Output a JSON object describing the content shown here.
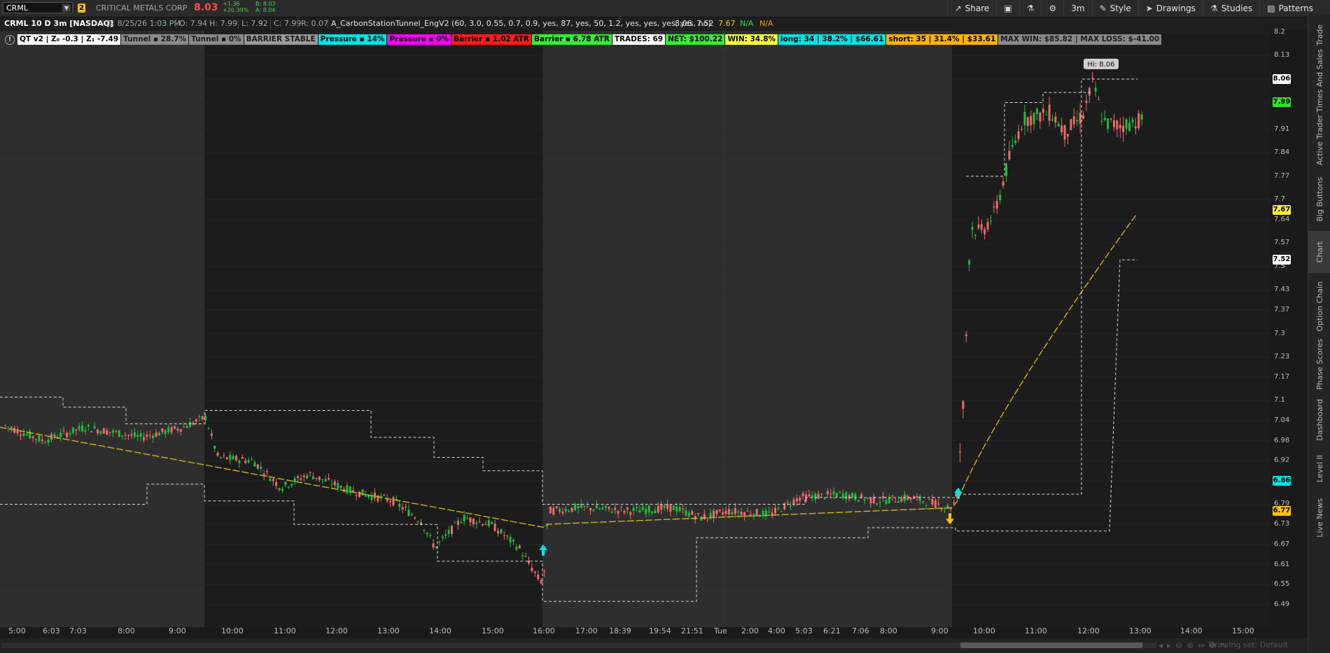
{
  "toolbar": {
    "symbol": "CRML",
    "link_number": "2",
    "company_name": "CRITICAL METALS CORP",
    "last_price": "8.03",
    "change": "+1.36",
    "change_pct": "+20.39%",
    "bid": "B: 8.03",
    "ask": "A: 8.04",
    "share_label": "Share",
    "timeframe_label": "3m",
    "style_label": "Style",
    "drawings_label": "Drawings",
    "studies_label": "Studies",
    "patterns_label": "Patterns"
  },
  "infobar": {
    "title": "CRML 10 D 3m [NASDAQ]",
    "date": "D: 8/25/26 1:03 PM",
    "open": "O: 7.94",
    "high": "H: 7.99",
    "low": "L: 7.92",
    "close": "C: 7.99",
    "range": "R: 0.07",
    "study": "A_CarbonStationTunnel_EngV2 (60, 3.0, 0.55, 0.7, 0.9, yes, 87, yes, 50, 1.2, yes, yes, yes, yes, no)",
    "v1": "8.06",
    "v2": "7.52",
    "v3": "7.67",
    "v4": "N/A",
    "v5": "N/A"
  },
  "stats": [
    {
      "text": "QT v2 | Z₀ -0.3 | Z₁ -7.49",
      "bg": "#ffffff",
      "fg": "#000000"
    },
    {
      "text": "Tunnel ▪ 28.7%",
      "bg": "#8a8a8a",
      "fg": "#1a1a1a"
    },
    {
      "text": "Tunnel ▪ 0%",
      "bg": "#8a8a8a",
      "fg": "#1a1a1a"
    },
    {
      "text": "BARRIER STABLE",
      "bg": "#9a9a9a",
      "fg": "#1a1a1a"
    },
    {
      "text": "Pressure ▪ 14%",
      "bg": "#00e5e5",
      "fg": "#000000"
    },
    {
      "text": "Pressure ▪ 0%",
      "bg": "#ff00ff",
      "fg": "#000000"
    },
    {
      "text": "Barrier ▪ 1.02 ATR",
      "bg": "#ff1a1a",
      "fg": "#000000"
    },
    {
      "text": "Barrier ▪ 6.78 ATR",
      "bg": "#33ee33",
      "fg": "#000000"
    },
    {
      "text": "TRADES: 69",
      "bg": "#ffffff",
      "fg": "#000000"
    },
    {
      "text": "NET: $100.22",
      "bg": "#33ee33",
      "fg": "#000000"
    },
    {
      "text": "WIN: 34.8%",
      "bg": "#ffff33",
      "fg": "#000000"
    },
    {
      "text": "long: 34 | 38.2% | $66.61",
      "bg": "#00e5e5",
      "fg": "#000000"
    },
    {
      "text": "short: 35 | 31.4% | $33.61",
      "bg": "#ffb300",
      "fg": "#000000"
    },
    {
      "text": "MAX WIN: $85.82 | MAX LOSS: $-41.00",
      "bg": "#8a8a8a",
      "fg": "#1a1a1a"
    }
  ],
  "chart": {
    "hi_label": "Hi: 8.06",
    "y_ticks": [
      "8.2",
      "8.13",
      "8.06",
      "7.99",
      "7.91",
      "7.84",
      "7.77",
      "7.7",
      "7.64",
      "7.57",
      "7.5",
      "7.43",
      "7.37",
      "7.3",
      "7.23",
      "7.17",
      "7.1",
      "7.04",
      "6.98",
      "6.92",
      "6.86",
      "6.79",
      "6.73",
      "6.67",
      "6.61",
      "6.55",
      "6.49"
    ],
    "badges": [
      {
        "value": "8.06",
        "bg": "#ffffff",
        "fg": "#000000"
      },
      {
        "value": "7.99",
        "bg": "#33dd33",
        "fg": "#000000"
      },
      {
        "value": "7.67",
        "bg": "#ffee33",
        "fg": "#000000"
      },
      {
        "value": "7.52",
        "bg": "#ffffff",
        "fg": "#000000"
      },
      {
        "value": "6.86",
        "bg": "#00e5e5",
        "fg": "#000000"
      },
      {
        "value": "6.77",
        "bg": "#ffc107",
        "fg": "#000000"
      }
    ],
    "x_ticks": [
      "5:00",
      "6:03",
      "7:03",
      "8:00",
      "9:00",
      "10:00",
      "11:00",
      "12:00",
      "13:00",
      "14:00",
      "15:00",
      "16:00",
      "17:00",
      "18:39",
      "19:54",
      "21:51",
      "Tue",
      "2:00",
      "4:00",
      "5:03",
      "6:21",
      "7:06",
      "8:00",
      "9:00",
      "10:00",
      "11:00",
      "12:00",
      "13:00",
      "14:00",
      "15:00"
    ],
    "colors": {
      "up": "#1fbf3a",
      "down": "#f06a6a",
      "ema": "#c9b51a",
      "band": "#d8d8d8",
      "arrow_up": "#00e5e5",
      "arrow_down": "#ffc107"
    }
  },
  "rail": [
    "Trade",
    "Times And Sales",
    "Active Trader",
    "Big Buttons",
    "Chart",
    "Option Chain",
    "Phase Scores",
    "Dashboard",
    "Level II",
    "Live News"
  ],
  "bottom": {
    "drawing_set": "Drawing set: Default"
  }
}
